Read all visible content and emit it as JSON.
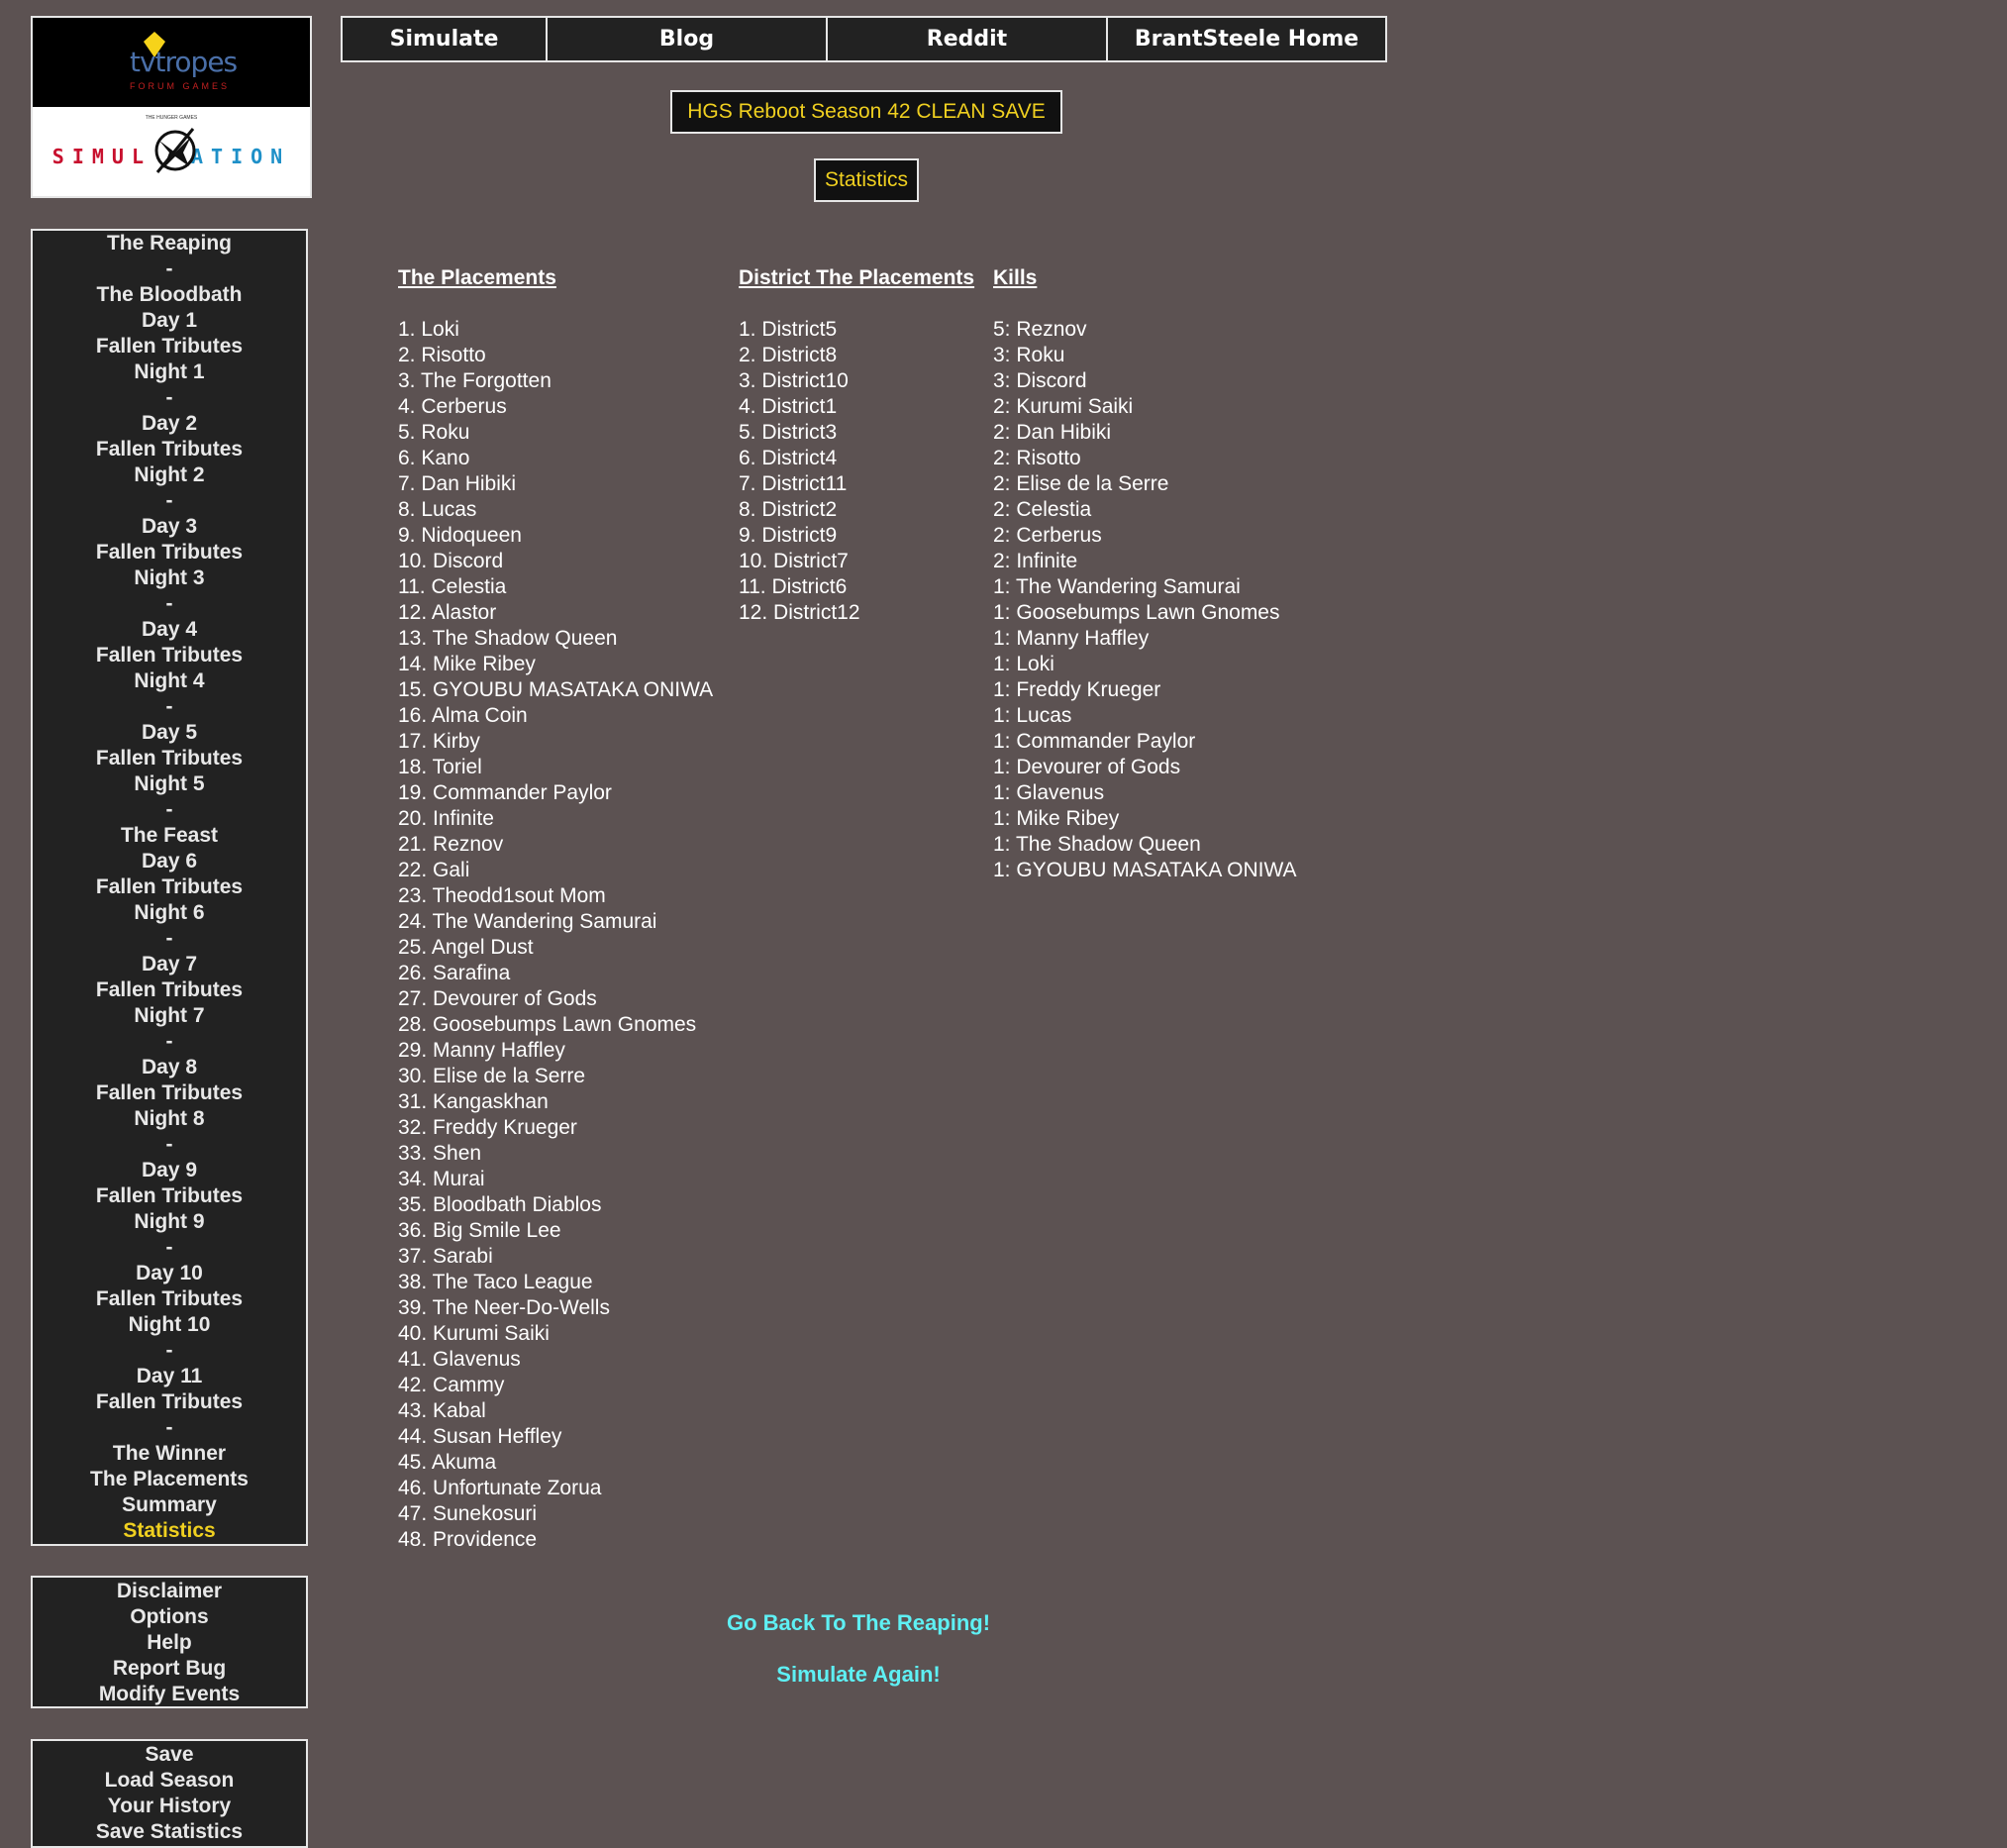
{
  "logo": {
    "tvtropes_text": "tvtropes",
    "forum_games": "FORUM GAMES",
    "hunger_games": "THE HUNGER GAMES",
    "simulation_left": "SIMUL",
    "simulation_right": "ATION"
  },
  "topnav": [
    "Simulate",
    "Blog",
    "Reddit",
    "BrantSteele Home"
  ],
  "season_title": "HGS Reboot Season 42 CLEAN SAVE",
  "page_label": "Statistics",
  "sidebar_nav": [
    "The Reaping",
    "-",
    "The Bloodbath",
    "Day 1",
    "Fallen Tributes",
    "Night 1",
    "-",
    "Day 2",
    "Fallen Tributes",
    "Night 2",
    "-",
    "Day 3",
    "Fallen Tributes",
    "Night 3",
    "-",
    "Day 4",
    "Fallen Tributes",
    "Night 4",
    "-",
    "Day 5",
    "Fallen Tributes",
    "Night 5",
    "-",
    "The Feast",
    "Day 6",
    "Fallen Tributes",
    "Night 6",
    "-",
    "Day 7",
    "Fallen Tributes",
    "Night 7",
    "-",
    "Day 8",
    "Fallen Tributes",
    "Night 8",
    "-",
    "Day 9",
    "Fallen Tributes",
    "Night 9",
    "-",
    "Day 10",
    "Fallen Tributes",
    "Night 10",
    "-",
    "Day 11",
    "Fallen Tributes",
    "-",
    "The Winner",
    "The Placements",
    "Summary",
    "Statistics"
  ],
  "sidebar_active": "Statistics",
  "sidebar_misc": [
    "Disclaimer",
    "Options",
    "Help",
    "Report Bug",
    "Modify Events"
  ],
  "sidebar_save": [
    "Save",
    "Load Season",
    "Your History",
    "Save Statistics"
  ],
  "placements": {
    "header": "The Placements",
    "items": [
      "1. Loki",
      "2. Risotto",
      "3. The Forgotten",
      "4. Cerberus",
      "5. Roku",
      "6. Kano",
      "7. Dan Hibiki",
      "8. Lucas",
      "9. Nidoqueen",
      "10. Discord",
      "11. Celestia",
      "12. Alastor",
      "13. The Shadow Queen",
      "14. Mike Ribey",
      "15. GYOUBU MASATAKA ONIWA",
      "16. Alma Coin",
      "17. Kirby",
      "18. Toriel",
      "19. Commander Paylor",
      "20. Infinite",
      "21. Reznov",
      "22. Gali",
      "23. Theodd1sout Mom",
      "24. The Wandering Samurai",
      "25. Angel Dust",
      "26. Sarafina",
      "27. Devourer of Gods",
      "28. Goosebumps Lawn Gnomes",
      "29. Manny Haffley",
      "30. Elise de la Serre",
      "31. Kangaskhan",
      "32. Freddy Krueger",
      "33. Shen",
      "34. Murai",
      "35. Bloodbath Diablos",
      "36. Big Smile Lee",
      "37. Sarabi",
      "38. The Taco League",
      "39. The Neer-Do-Wells",
      "40. Kurumi Saiki",
      "41. Glavenus",
      "42. Cammy",
      "43. Kabal",
      "44. Susan Heffley",
      "45. Akuma",
      "46. Unfortunate Zorua",
      "47. Sunekosuri",
      "48. Providence"
    ]
  },
  "district_placements": {
    "header": "District The Placements",
    "items": [
      "1. District5",
      "2. District8",
      "3. District10",
      "4. District1",
      "5. District3",
      "6. District4",
      "7. District11",
      "8. District2",
      "9. District9",
      "10. District7",
      "11. District6",
      "12. District12"
    ]
  },
  "kills": {
    "header": "Kills",
    "items": [
      "5: Reznov",
      "3: Roku",
      "3: Discord",
      "2: Kurumi Saiki",
      "2: Dan Hibiki",
      "2: Risotto",
      "2: Elise de la Serre",
      "2: Celestia",
      "2: Cerberus",
      "2: Infinite",
      "1: The Wandering Samurai",
      "1: Goosebumps Lawn Gnomes",
      "1: Manny Haffley",
      "1: Loki",
      "1: Freddy Krueger",
      "1: Lucas",
      "1: Commander Paylor",
      "1: Devourer of Gods",
      "1: Glavenus",
      "1: Mike Ribey",
      "1: The Shadow Queen",
      "1: GYOUBU MASATAKA ONIWA"
    ]
  },
  "links": {
    "back": "Go Back To The Reaping!",
    "again": "Simulate Again!"
  },
  "colors": {
    "background": "#5c5252",
    "panel": "#222222",
    "accent_yellow": "#f0d020",
    "link_cyan": "#5ef0f4"
  }
}
